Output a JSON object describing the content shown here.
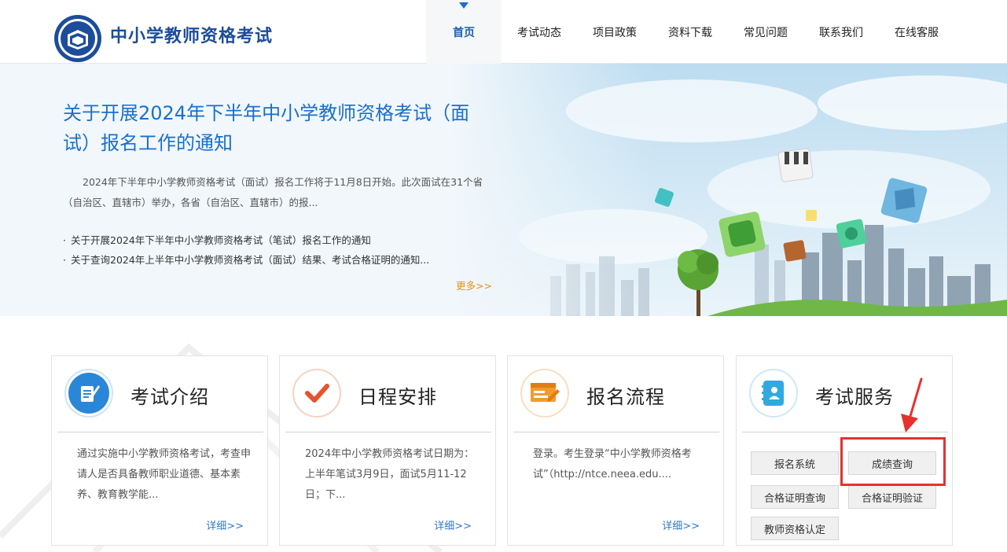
{
  "header": {
    "site_title": "中小学教师资格考试",
    "nav": [
      {
        "label": "首页",
        "active": true
      },
      {
        "label": "考试动态"
      },
      {
        "label": "项目政策"
      },
      {
        "label": "资料下载"
      },
      {
        "label": "常见问题"
      },
      {
        "label": "联系我们"
      },
      {
        "label": "在线客服"
      }
    ]
  },
  "banner": {
    "title": "关于开展2024年下半年中小学教师资格考试（面试）报名工作的通知",
    "desc": "2024年下半年中小学教师资格考试（面试）报名工作将于11月8日开始。此次面试在31个省（自治区、直辖市）举办，各省（自治区、直辖市）的报...",
    "links": [
      "关于开展2024年下半年中小学教师资格考试（笔试）报名工作的通知",
      "关于查询2024年上半年中小学教师资格考试（面试）结果、考试合格证明的通知..."
    ],
    "more": "更多>>"
  },
  "cards": [
    {
      "title": "考试介绍",
      "body": "通过实施中小学教师资格考试，考查申请人是否具备教师职业道德、基本素养、教育教学能...",
      "more": "详细>>",
      "icon": "pencil-note-icon"
    },
    {
      "title": "日程安排",
      "body": "2024年中小学教师资格考试日期为：上半年笔试3月9日，面试5月11-12日；下...",
      "more": "详细>>",
      "icon": "checkmark-icon"
    },
    {
      "title": "报名流程",
      "body": "登录。考生登录“中小学教师资格考试”（http://ntce.neea.edu....",
      "more": "详细>>",
      "icon": "registration-form-icon"
    },
    {
      "title": "考试服务",
      "icon": "address-book-icon",
      "buttons": [
        "报名系统",
        "成绩查询",
        "合格证明查询",
        "合格证明验证",
        "教师资格认定"
      ]
    }
  ],
  "colors": {
    "brand_blue": "#1a6fce",
    "accent_orange": "#e8901e",
    "highlight_red": "#e5322d"
  }
}
